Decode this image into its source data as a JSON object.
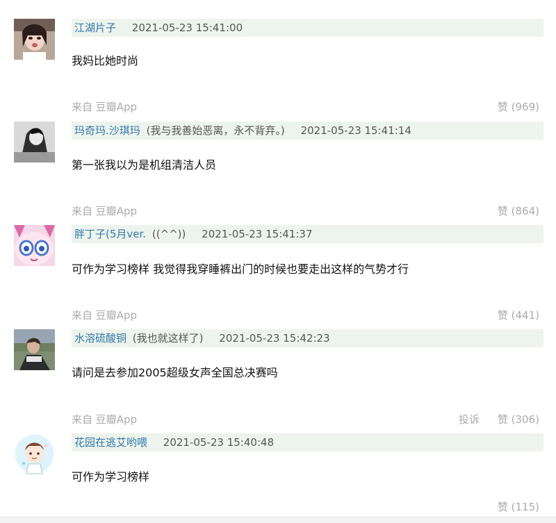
{
  "comments": [
    {
      "author": "江湖片子",
      "signature": "",
      "time": "2021-05-23 15:41:00",
      "content": "我妈比她时尚",
      "source": "来自 豆瓣App",
      "vote": "赞 (969)",
      "report": ""
    },
    {
      "author": "玛奇玛.沙琪玛",
      "signature": "(我与我善始恶离，永不背弃。)",
      "time": "2021-05-23 15:41:14",
      "content": "第一张我以为是机组清洁人员",
      "source": "来自 豆瓣App",
      "vote": "赞 (864)",
      "report": ""
    },
    {
      "author": "胖丁子(5月ver.",
      "signature": "((^^))",
      "time": "2021-05-23 15:41:37",
      "content": "可作为学习榜样 我觉得我穿睡裤出门的时候也要走出这样的气势才行",
      "source": "来自 豆瓣App",
      "vote": "赞 (441)",
      "report": ""
    },
    {
      "author": "水溶硫酸铜",
      "signature": "(我也就这样了)",
      "time": "2021-05-23 15:42:23",
      "content": "请问是去参加2005超级女声全国总决赛吗",
      "source": "来自 豆瓣App",
      "vote": "赞 (306)",
      "report": "投诉"
    },
    {
      "author": "花园在逃艾哟喂",
      "signature": "",
      "time": "2021-05-23 15:40:48",
      "content": "可作为学习榜样",
      "source": "",
      "vote": "赞 (115)",
      "report": ""
    }
  ],
  "colors": {
    "author_link": "#3377aa",
    "header_bg": "#edf4ed",
    "meta_gray": "#aaaaaa"
  }
}
